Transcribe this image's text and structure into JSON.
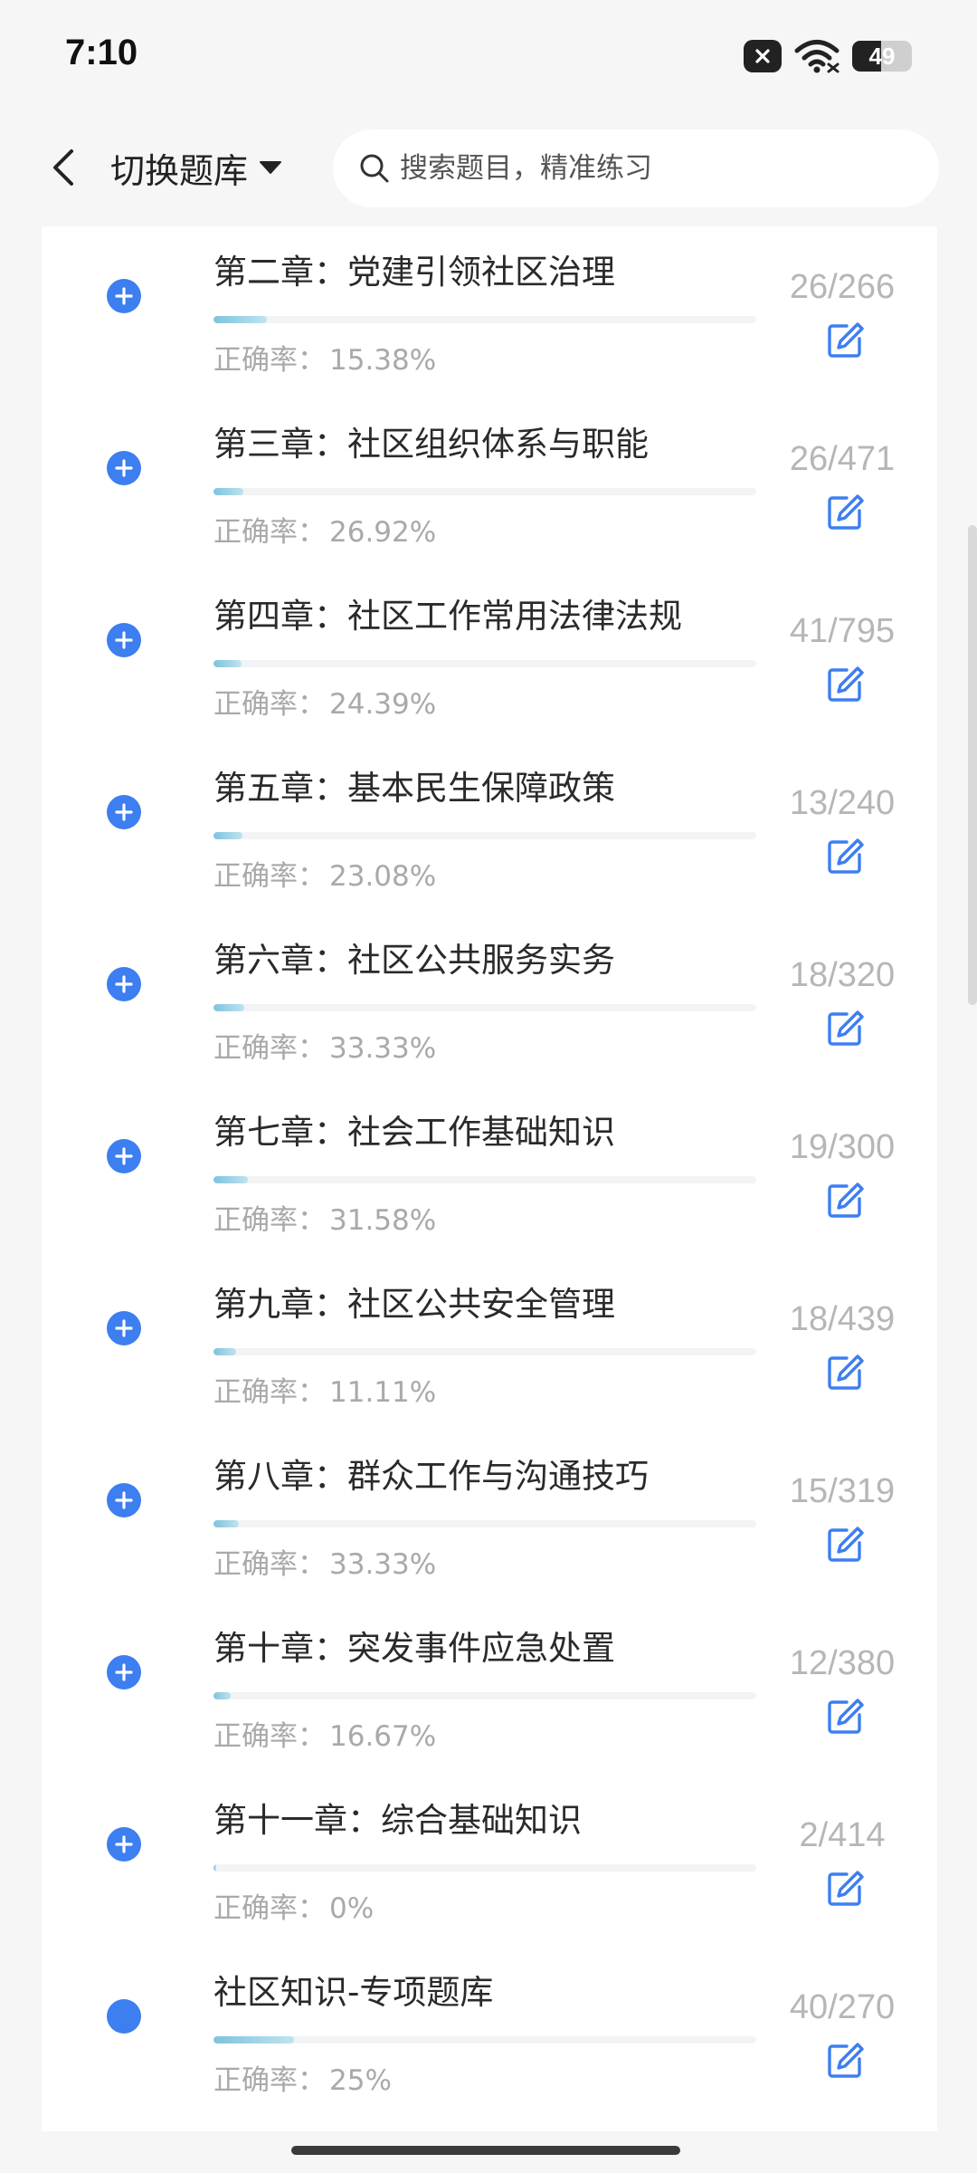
{
  "status": {
    "time": "7:10",
    "battery": "49",
    "battery_level": 0.49,
    "icons": [
      "close-badge-icon",
      "wifi-icon",
      "battery-icon"
    ]
  },
  "header": {
    "back_icon": "chevron-left-icon",
    "bank_switch_label": "切换题库",
    "search_placeholder": "搜索题目，精准练习"
  },
  "accuracy_label": "正确率：",
  "colors": {
    "accent": "#3d7ef0",
    "progress": "#7ec3dd",
    "muted_text": "#a9a9a9"
  },
  "chapters": [
    {
      "title": "第二章：党建引领社区治理",
      "accuracy": "15.38%",
      "done": 26,
      "total": 266,
      "count": "26/266",
      "progress": 0.098,
      "icon": "add-circle-icon"
    },
    {
      "title": "第三章：社区组织体系与职能",
      "accuracy": "26.92%",
      "done": 26,
      "total": 471,
      "count": "26/471",
      "progress": 0.055,
      "icon": "add-circle-icon"
    },
    {
      "title": "第四章：社区工作常用法律法规",
      "accuracy": "24.39%",
      "done": 41,
      "total": 795,
      "count": "41/795",
      "progress": 0.052,
      "icon": "add-circle-icon"
    },
    {
      "title": "第五章：基本民生保障政策",
      "accuracy": "23.08%",
      "done": 13,
      "total": 240,
      "count": "13/240",
      "progress": 0.054,
      "icon": "add-circle-icon"
    },
    {
      "title": "第六章：社区公共服务实务",
      "accuracy": "33.33%",
      "done": 18,
      "total": 320,
      "count": "18/320",
      "progress": 0.056,
      "icon": "add-circle-icon"
    },
    {
      "title": "第七章：社会工作基础知识",
      "accuracy": "31.58%",
      "done": 19,
      "total": 300,
      "count": "19/300",
      "progress": 0.063,
      "icon": "add-circle-icon"
    },
    {
      "title": "第九章：社区公共安全管理",
      "accuracy": "11.11%",
      "done": 18,
      "total": 439,
      "count": "18/439",
      "progress": 0.041,
      "icon": "add-circle-icon"
    },
    {
      "title": "第八章：群众工作与沟通技巧",
      "accuracy": "33.33%",
      "done": 15,
      "total": 319,
      "count": "15/319",
      "progress": 0.047,
      "icon": "add-circle-icon"
    },
    {
      "title": "第十章：突发事件应急处置",
      "accuracy": "16.67%",
      "done": 12,
      "total": 380,
      "count": "12/380",
      "progress": 0.032,
      "icon": "add-circle-icon"
    },
    {
      "title": "第十一章：综合基础知识",
      "accuracy": "0%",
      "done": 2,
      "total": 414,
      "count": "2/414",
      "progress": 0.005,
      "icon": "add-circle-icon"
    },
    {
      "title": "社区知识-专项题库",
      "accuracy": "25%",
      "done": 40,
      "total": 270,
      "count": "40/270",
      "progress": 0.148,
      "icon": "filled-circle-icon"
    }
  ]
}
